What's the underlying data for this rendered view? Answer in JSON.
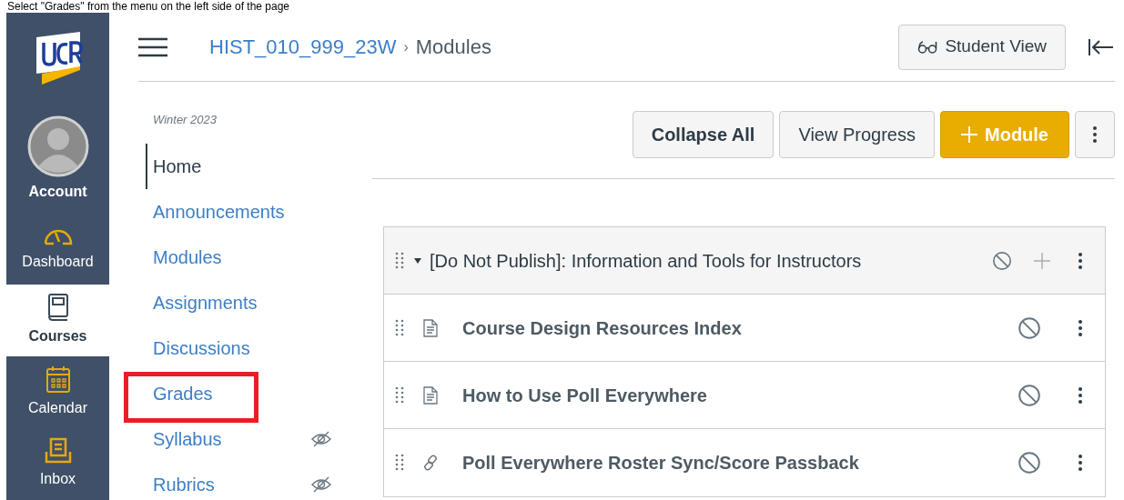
{
  "caption": "Select \"Grades\" from the menu on the left side of the page",
  "global_nav": [
    {
      "label": "Account",
      "kind": "avatar",
      "selected": false
    },
    {
      "label": "Dashboard",
      "kind": "dashboard",
      "selected": false
    },
    {
      "label": "Courses",
      "kind": "courses",
      "selected": true
    },
    {
      "label": "Calendar",
      "kind": "calendar",
      "selected": false
    },
    {
      "label": "Inbox",
      "kind": "inbox",
      "selected": false
    }
  ],
  "breadcrumb": {
    "course": "HIST_010_999_23W",
    "separator": "›",
    "page": "Modules"
  },
  "student_view_button": "Student View",
  "course_nav": {
    "term": "Winter 2023",
    "items": [
      {
        "label": "Home",
        "selected": true,
        "hidden": false,
        "highlighted": false
      },
      {
        "label": "Announcements",
        "selected": false,
        "hidden": false,
        "highlighted": false
      },
      {
        "label": "Modules",
        "selected": false,
        "hidden": false,
        "highlighted": false
      },
      {
        "label": "Assignments",
        "selected": false,
        "hidden": false,
        "highlighted": false
      },
      {
        "label": "Discussions",
        "selected": false,
        "hidden": false,
        "highlighted": false
      },
      {
        "label": "Grades",
        "selected": false,
        "hidden": false,
        "highlighted": true
      },
      {
        "label": "Syllabus",
        "selected": false,
        "hidden": true,
        "highlighted": false
      },
      {
        "label": "Rubrics",
        "selected": false,
        "hidden": true,
        "highlighted": false
      }
    ]
  },
  "toolbar": {
    "collapse_all": "Collapse All",
    "view_progress": "View Progress",
    "add_module": "Module"
  },
  "module": {
    "title": "[Do Not Publish]: Information and Tools for Instructors",
    "expanded": true,
    "published": false,
    "items": [
      {
        "title": "Course Design Resources Index",
        "kind": "page",
        "published": false
      },
      {
        "title": "How to Use Poll Everywhere",
        "kind": "page",
        "published": false
      },
      {
        "title": "Poll Everywhere Roster Sync/Score Passback",
        "kind": "link",
        "published": false
      }
    ]
  }
}
